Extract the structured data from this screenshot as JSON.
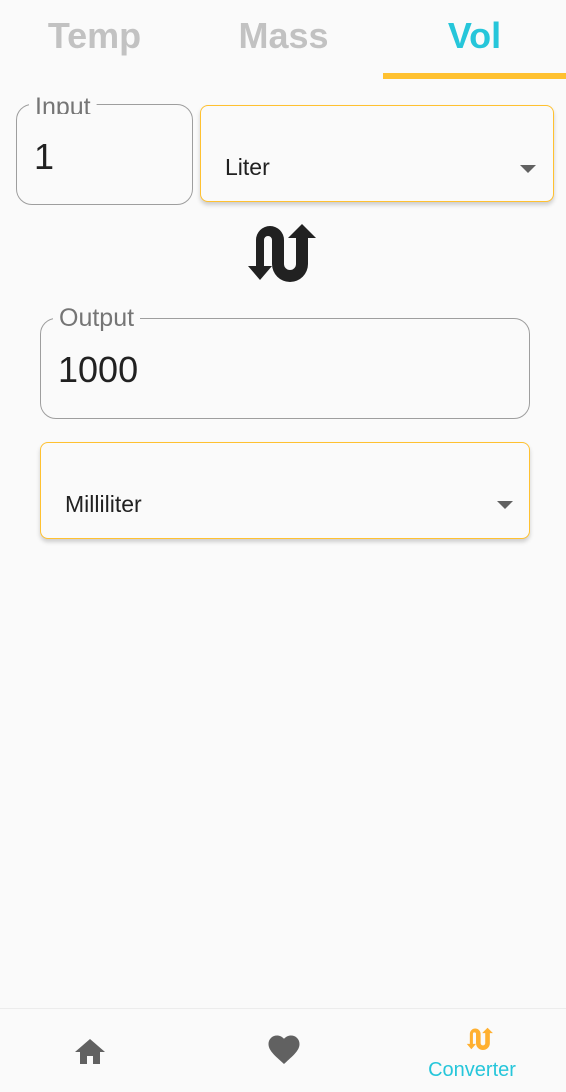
{
  "tabs": [
    {
      "label": "Temp",
      "active": false
    },
    {
      "label": "Mass",
      "active": false
    },
    {
      "label": "Vol",
      "active": true
    }
  ],
  "converter": {
    "input_label": "Input",
    "input_value": "1",
    "from_unit": "Liter",
    "swap_icon": "swap-vertical-icon",
    "output_label": "Output",
    "output_value": "1000",
    "to_unit": "Milliliter"
  },
  "bottom_nav": {
    "items": [
      {
        "icon": "home-icon",
        "label": ""
      },
      {
        "icon": "heart-icon",
        "label": ""
      },
      {
        "icon": "swap-vertical-icon",
        "label": "Converter",
        "active": true
      }
    ]
  },
  "colors": {
    "accent": "#26c6da",
    "highlight": "#ffc130",
    "inactive_tab": "#c2c2c2",
    "nav_icon": "#616161"
  }
}
